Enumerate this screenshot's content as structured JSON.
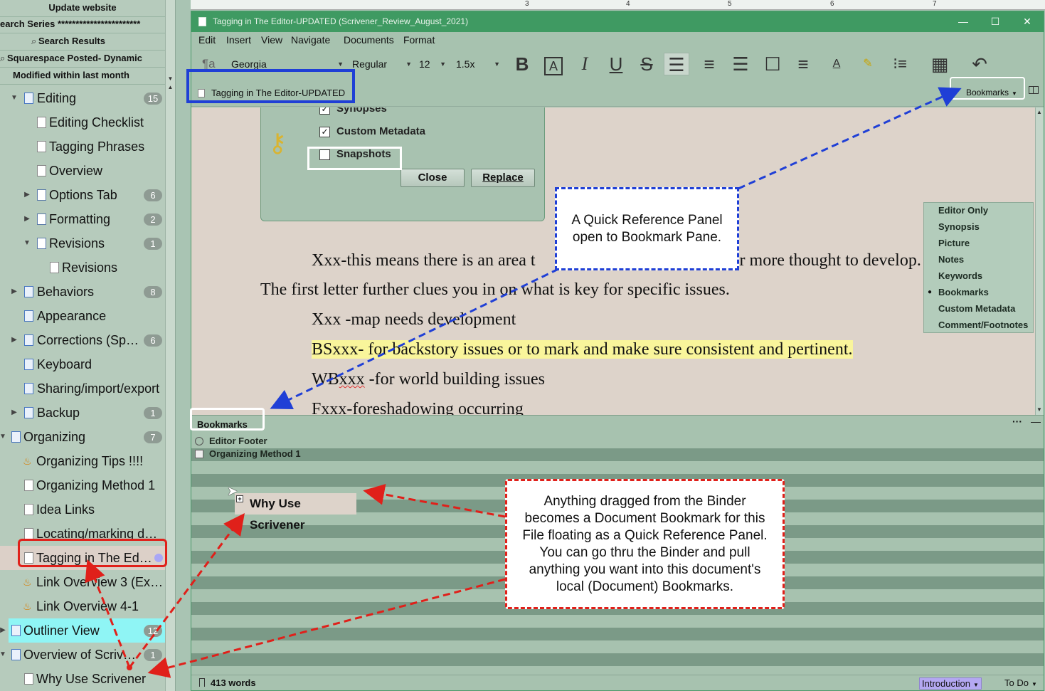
{
  "binder": {
    "collections": [
      {
        "label": "Update website"
      },
      {
        "label": "earch Series ***********************"
      },
      {
        "label": "Search Results"
      },
      {
        "label": "Squarespace Posted- Dynamic"
      },
      {
        "label": "Modified within last month"
      }
    ],
    "items": [
      {
        "label": "Editing",
        "badge": "15"
      },
      {
        "label": "Editing Checklist"
      },
      {
        "label": "Tagging Phrases"
      },
      {
        "label": "Overview"
      },
      {
        "label": "Options Tab",
        "badge": "6"
      },
      {
        "label": "Formatting",
        "badge": "2"
      },
      {
        "label": "Revisions",
        "badge": "1"
      },
      {
        "label": "Revisions"
      },
      {
        "label": "Behaviors",
        "badge": "8"
      },
      {
        "label": "Appearance"
      },
      {
        "label": "Corrections (Spelling...",
        "badge": "6"
      },
      {
        "label": "Keyboard"
      },
      {
        "label": "Sharing/import/export"
      },
      {
        "label": "Backup",
        "badge": "1"
      },
      {
        "label": "Organizing",
        "badge": "7"
      },
      {
        "label": "Organizing Tips !!!!"
      },
      {
        "label": "Organizing Method 1"
      },
      {
        "label": "Idea Links"
      },
      {
        "label": "Locating/marking do..."
      },
      {
        "label": "Tagging in The Edit..."
      },
      {
        "label": "Link Overview 3 (Exte..."
      },
      {
        "label": "Link Overview 4-1"
      },
      {
        "label": "Outliner View",
        "badge": "12"
      },
      {
        "label": "Overview of Scrivener",
        "badge": "1"
      },
      {
        "label": "Why Use Scrivener"
      }
    ]
  },
  "ruler": {
    "ticks": [
      "3",
      "4",
      "5",
      "6",
      "7"
    ]
  },
  "window": {
    "title": "Tagging in The Editor-UPDATED (Scrivener_Review_August_2021)",
    "controls": {
      "min": "—",
      "max": "☐",
      "close": "✕"
    }
  },
  "menu": [
    "Edit",
    "Insert",
    "View",
    "Navigate",
    "Documents",
    "Format"
  ],
  "format": {
    "style_icon": "¶a",
    "font": "Georgia",
    "weight": "Regular",
    "size": "12",
    "spacing": "1.5x"
  },
  "header": {
    "doc_title": "Tagging in The Editor-UPDATED",
    "qr_view": "Bookmarks"
  },
  "dialog": {
    "checks": [
      {
        "label": "Synopses",
        "checked": "✓"
      },
      {
        "label": "Custom Metadata",
        "checked": "✓"
      },
      {
        "label": "Snapshots",
        "checked": ""
      }
    ],
    "close": "Close",
    "replace": "Replace"
  },
  "view_menu": [
    "Editor Only",
    "Synopsis",
    "Picture",
    "Notes",
    "Keywords",
    "Bookmarks",
    "Custom Metadata",
    "Comment/Footnotes"
  ],
  "editor": {
    "lines": [
      {
        "pre": "Xxx-this means there is an area t",
        "post": "rk or more thought to develop."
      },
      {
        "text": "The first letter further clues you in on what is key for specific issues."
      },
      {
        "text": "Xxx -map needs development"
      },
      {
        "text": "BSxxx- for backstory issues or to mark and make sure consistent and pertinent."
      },
      {
        "pre": "WB",
        "squig": "xxx",
        "post": " -for world building issues"
      },
      {
        "text": "Fxxx-foreshadowing occurring"
      }
    ]
  },
  "bookmarks": {
    "title": "Bookmarks",
    "more": "···",
    "items": [
      "Editor Footer",
      "Organizing Method 1"
    ],
    "dragged": "Why Use Scrivener"
  },
  "footer": {
    "words": "413 words",
    "label": "Introduction",
    "status": "To Do"
  },
  "annotations": {
    "blue_callout": "A Quick Reference Panel open to Bookmark Pane.",
    "red_callout": "Anything dragged from the Binder becomes a Document Bookmark for this File floating as a Quick Reference Panel. You can go thru the Binder and pull anything you want into this document's local (Document) Bookmarks.",
    "blue_color": "#1f3fd6",
    "red_color": "#e0201a"
  }
}
